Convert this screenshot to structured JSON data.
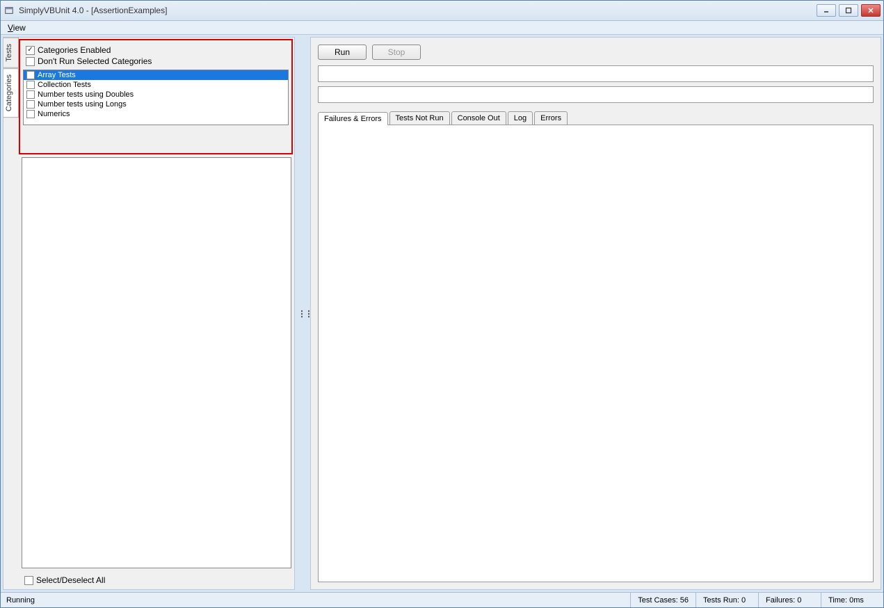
{
  "title": "SimplyVBUnit 4.0 - [AssertionExamples]",
  "menu": {
    "view": "View"
  },
  "sideTabs": {
    "tests": "Tests",
    "categories": "Categories"
  },
  "options": {
    "categoriesEnabled": "Categories Enabled",
    "dontRunSelected": "Don't Run Selected Categories"
  },
  "categories": [
    {
      "label": "Array Tests",
      "selected": true
    },
    {
      "label": "Collection Tests",
      "selected": false
    },
    {
      "label": "Number tests using Doubles",
      "selected": false
    },
    {
      "label": "Number tests using Longs",
      "selected": false
    },
    {
      "label": "Numerics",
      "selected": false
    }
  ],
  "selectAll": "Select/Deselect All",
  "buttons": {
    "run": "Run",
    "stop": "Stop"
  },
  "tabs": {
    "failures": "Failures & Errors",
    "notRun": "Tests Not Run",
    "console": "Console Out",
    "log": "Log",
    "errors": "Errors"
  },
  "status": {
    "state": "Running",
    "testCases": "Test Cases: 56",
    "testsRun": "Tests Run: 0",
    "failures": "Failures: 0",
    "time": "Time: 0ms"
  }
}
